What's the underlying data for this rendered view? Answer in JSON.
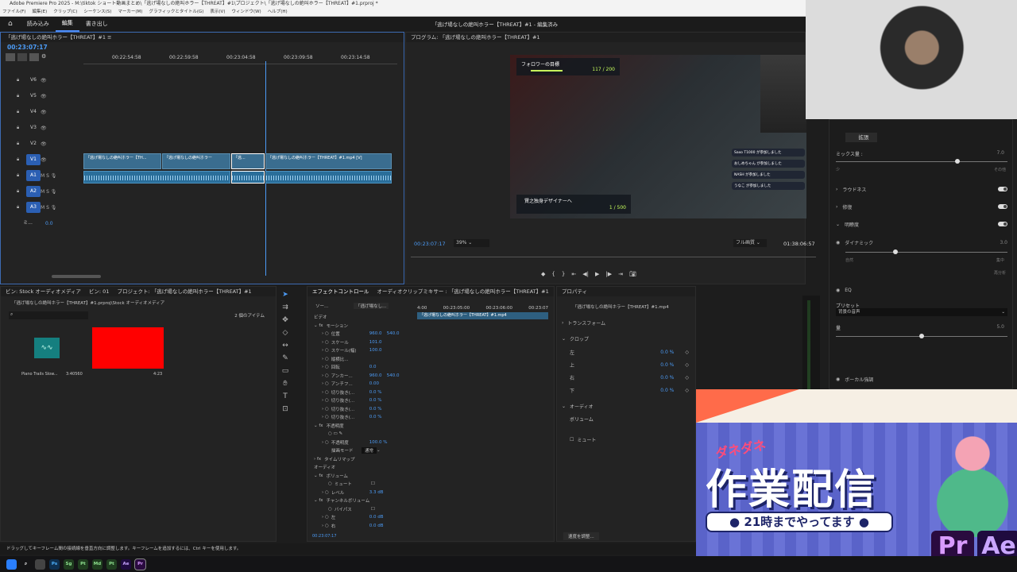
{
  "window": {
    "title": "Adobe Premiere Pro 2025 - M:\\tiktok ショート動画まとめ\\「逃げ場なしの絶叫ホラー【THREAT】#1\\プロジェクト\\「逃げ場なしの絶叫ホラー【THREAT】#1.prproj *"
  },
  "menu": [
    "ファイル(F)",
    "編集(E)",
    "クリップ(C)",
    "シーケンス(S)",
    "マーカー(M)",
    "グラフィックとタイトル(G)",
    "表示(V)",
    "ウィンドウ(W)",
    "ヘルプ(H)"
  ],
  "workspace": {
    "tabs": [
      "読み込み",
      "編集",
      "書き出し"
    ],
    "active": "編集",
    "center_title": "「逃げ場なしの絶叫ホラー【THREAT】#1 - 編集済み"
  },
  "timeline": {
    "tab": "「逃げ場なしの絶叫ホラー【THREAT】#1",
    "timecode": "00:23:07:17",
    "ruler": [
      "00:22:54:58",
      "00:22:59:58",
      "00:23:04:58",
      "00:23:09:58",
      "00:23:14:58"
    ],
    "tracks": [
      "V6",
      "V5",
      "V4",
      "V3",
      "V2",
      "V1",
      "A1",
      "A2",
      "A3",
      "ミ..."
    ],
    "mix_value": "0.0",
    "clips": [
      {
        "label": "「逃げ場なしの絶叫ホラー【TH..."
      },
      {
        "label": "「逃げ場なしの絶叫ホラー"
      },
      {
        "label": "「逃..."
      },
      {
        "label": "「逃げ場なしの絶叫ホラー【THREAT】#1.mp4 [V]"
      }
    ],
    "fx_badge": "fx"
  },
  "program": {
    "tab": "プログラム: 「逃げ場なしの絶叫ホラー【THREAT】#1",
    "timecode": "00:23:07:17",
    "zoom": "39%",
    "quality": "フル画質",
    "duration": "01:38:06:57",
    "overlay": {
      "follower_label": "フォロワーの目標",
      "follower_count": "117 / 200",
      "designer_label": "賢之独身デザイナーへ",
      "designer_count": "1 / 500",
      "chat": [
        "Saxo T1000 が参加しました",
        "おしめちゃん が参加しました",
        "NASH が参加しました",
        "うなこ が参加しました"
      ]
    }
  },
  "bin": {
    "tabs": [
      "ビン: Stock オーディオメディア",
      "ビン: 01",
      "プロジェクト: 「逃げ場なしの絶叫ホラー【THREAT】#1"
    ],
    "path": "「逃げ場なしの絶叫ホラー【THREAT】#1.prproj\\Stock オーディオメディア",
    "items_count": "2 個のアイテム",
    "item1_name": "Piano Trails Slow...",
    "item1_duration": "3:40560",
    "item2_duration": "4:23"
  },
  "effects": {
    "tabs": [
      "エフェクトコントロール",
      "オーディオクリップミキサー : 「逃げ場なしの絶叫ホラー【THREAT】#1"
    ],
    "source_tab": "ソー...",
    "seq_tab": "「逃げ場なし...",
    "clip_label": "「逃げ場なしの絶叫ホラー【THREAT】#1.mp4",
    "ruler": [
      "4:00",
      "00:23:05:00",
      "00:23:06:00",
      "00:23:07"
    ],
    "section_video": "ビデオ",
    "motion": "モーション",
    "rows": [
      {
        "name": "位置",
        "v1": "960.0",
        "v2": "540.0"
      },
      {
        "name": "スケール",
        "v1": "101.0",
        "v2": ""
      },
      {
        "name": "スケール(幅)",
        "v1": "100.0",
        "v2": ""
      },
      {
        "name": "縦横比...",
        "v1": "",
        "v2": ""
      },
      {
        "name": "回転",
        "v1": "0.0",
        "v2": ""
      },
      {
        "name": "アンカー...",
        "v1": "960.0",
        "v2": "540.0"
      },
      {
        "name": "アンチフ...",
        "v1": "0.00",
        "v2": ""
      },
      {
        "name": "切り抜き(...",
        "v1": "0.0 %",
        "v2": ""
      },
      {
        "name": "切り抜き(...",
        "v1": "0.0 %",
        "v2": ""
      },
      {
        "name": "切り抜き(...",
        "v1": "0.0 %",
        "v2": ""
      },
      {
        "name": "切り抜き(...",
        "v1": "0.0 %",
        "v2": ""
      }
    ],
    "opacity": "不透明度",
    "opacity_value": "100.0 %",
    "opacity_label": "不透明度",
    "blend_label": "描画モード",
    "blend_value": "通常",
    "time_remap": "タイムリマップ",
    "section_audio": "オーディオ",
    "volume": "ボリューム",
    "mute": "ミュート",
    "level": "レベル",
    "level_value": "3.3 dB",
    "channel_volume": "チャンネルボリューム",
    "bypass": "バイパス",
    "left": "左",
    "left_value": "0.0 dB",
    "right": "右",
    "right_value": "0.0 dB",
    "footer_time": "00:23:07:17"
  },
  "properties": {
    "tab": "プロパティ",
    "clip": "「逃げ場なしの絶叫ホラー【THREAT】#1.mp4",
    "transform": "トランスフォーム",
    "crop": "クロップ",
    "crop_rows": [
      {
        "name": "左",
        "val": "0.0 %"
      },
      {
        "name": "上",
        "val": "0.0 %"
      },
      {
        "name": "右",
        "val": "0.0 %"
      },
      {
        "name": "下",
        "val": "0.0 %"
      }
    ],
    "audio": "オーディオ",
    "volume": "ボリューム",
    "mute": "ミュート",
    "speed": "速度を調整..."
  },
  "essential": {
    "tab": "拡張",
    "mix_label": "ミックス量 :",
    "mix_value": "7.0",
    "mix_min": "少",
    "mix_max": "その他",
    "sections": [
      "ラウドネス",
      "修復",
      "明瞭度"
    ],
    "dynamic": "ダイナミック",
    "dynamic_value": "3.0",
    "dyn_min": "自然",
    "dyn_max": "集中",
    "reanalyze": "再分析",
    "eq": "EQ",
    "preset_label": "プリセット",
    "preset_value": "背景の音声",
    "amount": "量",
    "amount_value": "5.0",
    "vocal": "ボーカル強調"
  },
  "status": "ドラッグしてキーフレーム間の接続線を垂直方向に調整します。キーフレームを追加するには、Ctrl キーを使用します。",
  "banner": {
    "kicker": "ダネダネ",
    "title": "作業配信",
    "subtitle": "21時までやってます",
    "apps": [
      "Pr",
      "Ae"
    ]
  },
  "taskbar": [
    "Ps",
    "Sg",
    "Pt",
    "Md",
    "Pt",
    "Ae",
    "Pr"
  ],
  "colors": {
    "accent": "#4c8bf5",
    "timeline_clip": "#3a6d8f",
    "red_thumb": "#ff0000",
    "banner_bg": "#5a63c9"
  }
}
